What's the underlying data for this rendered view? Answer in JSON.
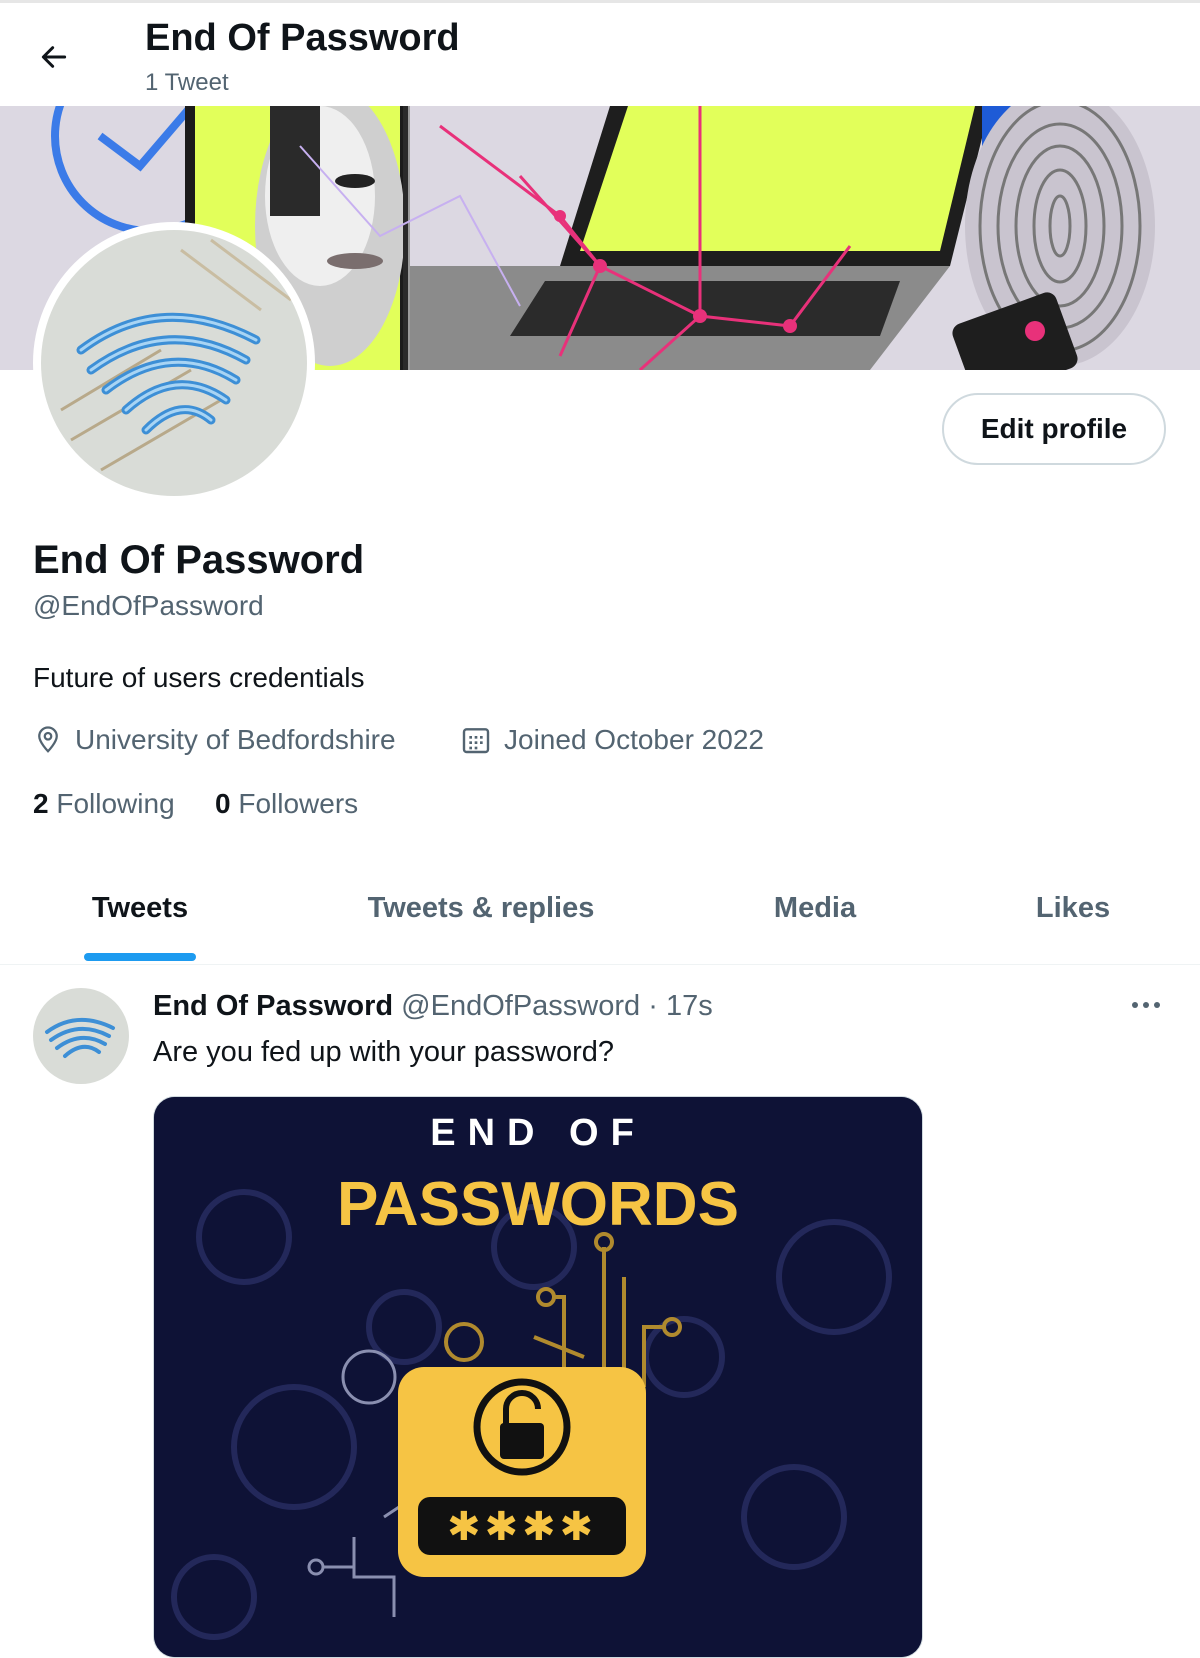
{
  "header": {
    "title": "End Of Password",
    "tweet_count": "1 Tweet",
    "back_icon": "arrow-left-icon"
  },
  "profile": {
    "display_name": "End Of Password",
    "handle": "@EndOfPassword",
    "bio": "Future of users credentials",
    "location": "University of Bedfordshire",
    "joined": "Joined October 2022",
    "following_count": "2",
    "following_label": "Following",
    "followers_count": "0",
    "followers_label": "Followers",
    "edit_label": "Edit profile"
  },
  "tabs": [
    {
      "label": "Tweets",
      "active": true
    },
    {
      "label": "Tweets & replies",
      "active": false
    },
    {
      "label": "Media",
      "active": false
    },
    {
      "label": "Likes",
      "active": false
    }
  ],
  "tweet": {
    "name": "End Of Password",
    "handle": "@EndOfPassword",
    "separator": "·",
    "time": "17s",
    "text": "Are you fed up with your password?",
    "media": {
      "line1": "END OF",
      "line2": "PASSWORDS",
      "code": "✱✱✱✱"
    }
  },
  "colors": {
    "accent": "#1d9bf0",
    "banner_yellow": "#e2ff5a",
    "banner_pink": "#e8317a",
    "media_bg": "#0e1236",
    "media_gold": "#f6c444"
  }
}
